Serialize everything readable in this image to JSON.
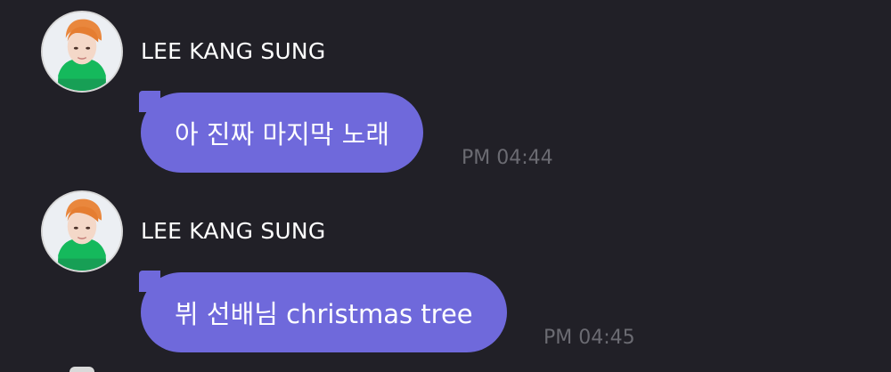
{
  "messages": [
    {
      "sender": "LEE KANG SUNG",
      "text": "아 진짜 마지막 노래",
      "time": "PM 04:44",
      "avatar_icon": "profile-photo"
    },
    {
      "sender": "LEE KANG SUNG",
      "text": "뷔 선배님 christmas tree",
      "time": "PM 04:45",
      "avatar_icon": "profile-photo"
    }
  ],
  "colors": {
    "background": "#212027",
    "bubble": "#6f69db",
    "sender_text": "#ffffff",
    "message_text": "#ffffff",
    "timestamp": "#6b6b72"
  }
}
